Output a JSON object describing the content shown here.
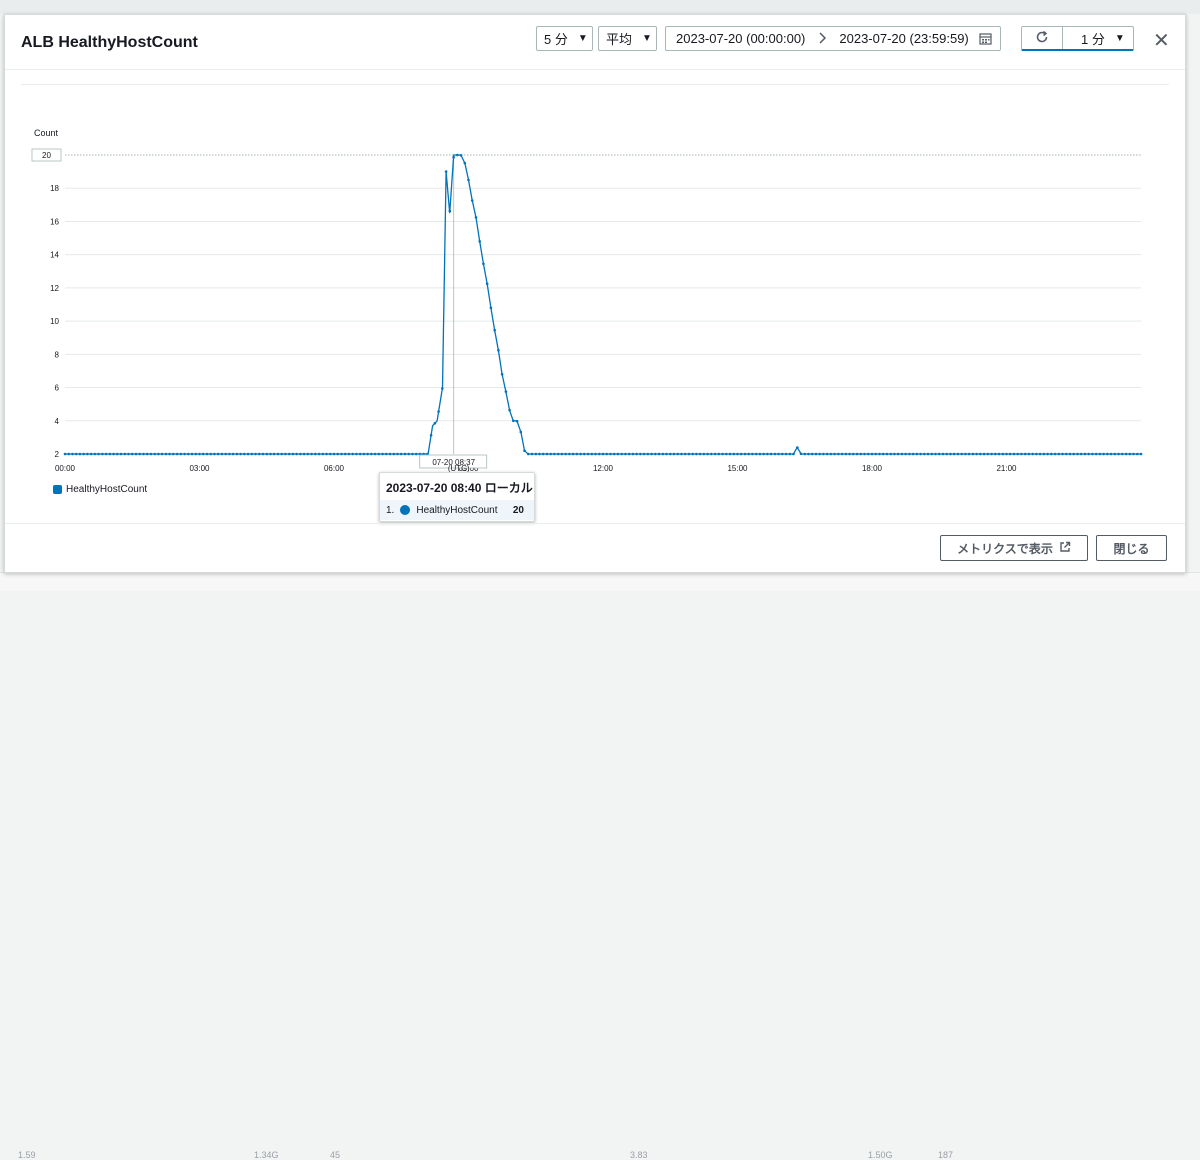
{
  "background_numbers": [
    "1.59",
    "1.34G",
    "45",
    "3.83",
    "1.50G",
    "187"
  ],
  "modal": {
    "title": "ALB HealthyHostCount",
    "period": "5 分",
    "statistic": "平均",
    "range_start": "2023-07-20 (00:00:00)",
    "range_end": "2023-07-20 (23:59:59)",
    "refresh_interval": "1 分",
    "icons": [
      "calendar-icon",
      "refresh-icon",
      "close-icon",
      "external-link-icon",
      "chevron-right-icon",
      "caret-down-icon"
    ]
  },
  "chart_data": {
    "type": "line",
    "ylabel": "Count",
    "ylim": [
      2,
      20
    ],
    "yticks": [
      "2",
      "4",
      "6",
      "8",
      "10",
      "12",
      "14",
      "16",
      "18",
      "20"
    ],
    "xlim_hours": [
      0,
      24
    ],
    "xticks": [
      "00:00",
      "03:00",
      "06:00",
      "09:00",
      "12:00",
      "15:00",
      "18:00",
      "21:00"
    ],
    "max_label": "20",
    "hover_label": "07-20 08:37",
    "hover_sublabel": "(UTC)",
    "series": [
      {
        "name": "HealthyHostCount",
        "color": "#0073bb",
        "points": [
          [
            0,
            2
          ],
          [
            8.0,
            2
          ],
          [
            8.1,
            2
          ],
          [
            8.2,
            3.7
          ],
          [
            8.3,
            4
          ],
          [
            8.42,
            6
          ],
          [
            8.5,
            19
          ],
          [
            8.58,
            16.5
          ],
          [
            8.67,
            20
          ],
          [
            8.75,
            20
          ],
          [
            8.83,
            20
          ],
          [
            8.92,
            19.5
          ],
          [
            9.0,
            18.5
          ],
          [
            9.08,
            17.3
          ],
          [
            9.17,
            16.2
          ],
          [
            9.25,
            14.8
          ],
          [
            9.33,
            13.5
          ],
          [
            9.42,
            12.2
          ],
          [
            9.5,
            10.8
          ],
          [
            9.58,
            9.5
          ],
          [
            9.67,
            8.2
          ],
          [
            9.75,
            6.8
          ],
          [
            9.83,
            5.8
          ],
          [
            9.92,
            4.6
          ],
          [
            10.0,
            4
          ],
          [
            10.08,
            4
          ],
          [
            10.17,
            3.3
          ],
          [
            10.25,
            2.2
          ],
          [
            10.33,
            2
          ],
          [
            16.25,
            2
          ],
          [
            16.33,
            2.4
          ],
          [
            16.42,
            2
          ],
          [
            24,
            2
          ]
        ]
      }
    ],
    "legend": [
      "HealthyHostCount"
    ]
  },
  "tooltip": {
    "title": "2023-07-20 08:40 ローカル",
    "rows": [
      {
        "index": "1.",
        "name": "HealthyHostCount",
        "value": "20"
      }
    ]
  },
  "footer": {
    "view_metrics": "メトリクスで表示",
    "close": "閉じる"
  }
}
